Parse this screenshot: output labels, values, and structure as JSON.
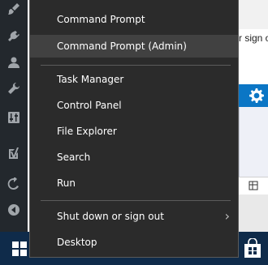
{
  "menu": {
    "items": [
      {
        "label": "Command Prompt"
      },
      {
        "label": "Command Prompt (Admin)"
      },
      {
        "label": "Task Manager"
      },
      {
        "label": "Control Panel"
      },
      {
        "label": "File Explorer"
      },
      {
        "label": "Search"
      },
      {
        "label": "Run"
      },
      {
        "label": "Shut down or sign out"
      },
      {
        "label": "Desktop"
      }
    ],
    "submenu_chevron": "›"
  },
  "sidebar": {
    "icons": [
      "paintbrush-icon",
      "plugin-icon",
      "users-icon",
      "wrench-icon",
      "settings-sliders-icon",
      "yoast-icon",
      "loop-icon",
      "collapse-icon"
    ]
  },
  "background": {
    "partial_text": "r sign o"
  },
  "colors": {
    "menu_bg": "#2b2b2b",
    "menu_highlight": "#414141",
    "sidebar_bg": "#23282d",
    "taskbar_bg": "#0f2b4a",
    "accent_blue": "#0b76c5"
  }
}
